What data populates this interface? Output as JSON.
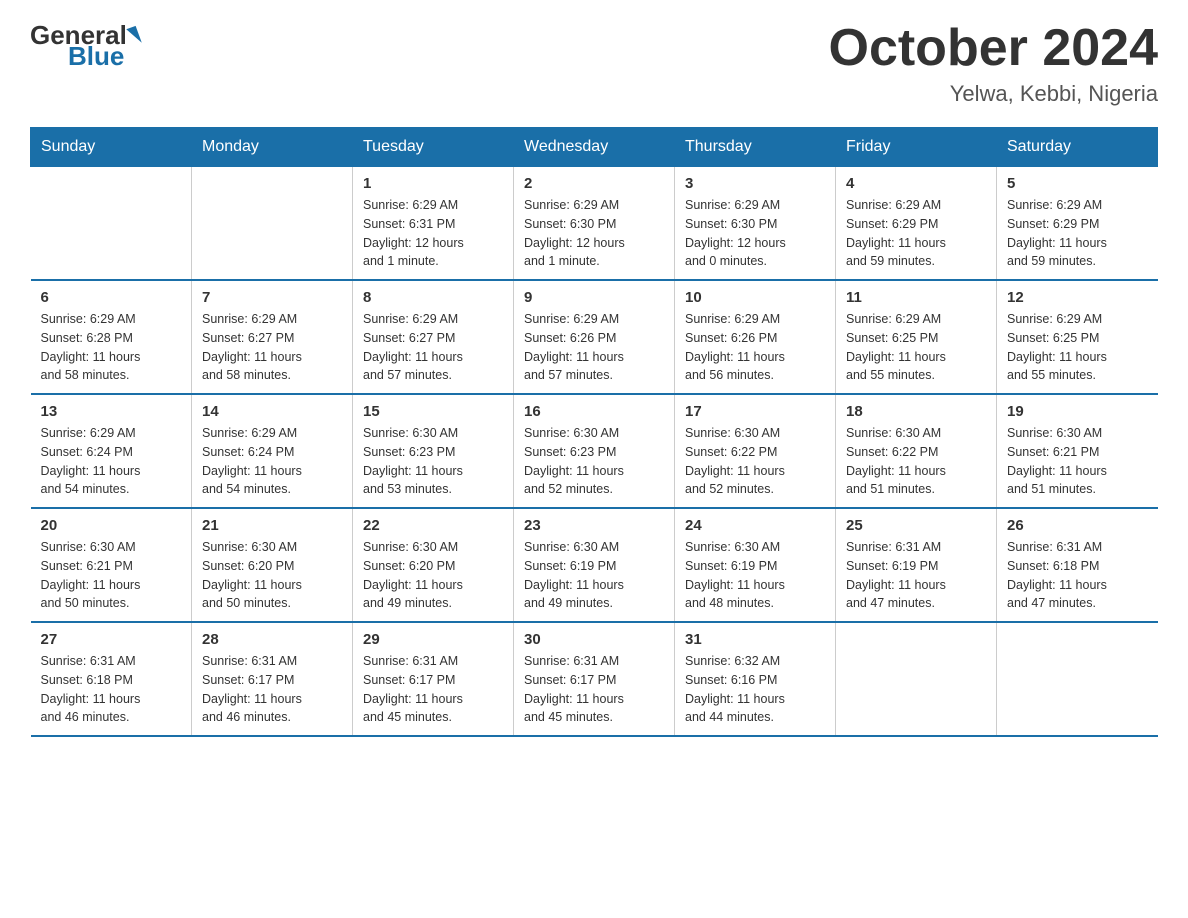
{
  "header": {
    "logo": {
      "general": "General",
      "blue": "Blue",
      "tagline": "Blue"
    },
    "title": "October 2024",
    "location": "Yelwa, Kebbi, Nigeria"
  },
  "weekdays": [
    "Sunday",
    "Monday",
    "Tuesday",
    "Wednesday",
    "Thursday",
    "Friday",
    "Saturday"
  ],
  "weeks": [
    [
      {
        "day": "",
        "info": ""
      },
      {
        "day": "",
        "info": ""
      },
      {
        "day": "1",
        "info": "Sunrise: 6:29 AM\nSunset: 6:31 PM\nDaylight: 12 hours\nand 1 minute."
      },
      {
        "day": "2",
        "info": "Sunrise: 6:29 AM\nSunset: 6:30 PM\nDaylight: 12 hours\nand 1 minute."
      },
      {
        "day": "3",
        "info": "Sunrise: 6:29 AM\nSunset: 6:30 PM\nDaylight: 12 hours\nand 0 minutes."
      },
      {
        "day": "4",
        "info": "Sunrise: 6:29 AM\nSunset: 6:29 PM\nDaylight: 11 hours\nand 59 minutes."
      },
      {
        "day": "5",
        "info": "Sunrise: 6:29 AM\nSunset: 6:29 PM\nDaylight: 11 hours\nand 59 minutes."
      }
    ],
    [
      {
        "day": "6",
        "info": "Sunrise: 6:29 AM\nSunset: 6:28 PM\nDaylight: 11 hours\nand 58 minutes."
      },
      {
        "day": "7",
        "info": "Sunrise: 6:29 AM\nSunset: 6:27 PM\nDaylight: 11 hours\nand 58 minutes."
      },
      {
        "day": "8",
        "info": "Sunrise: 6:29 AM\nSunset: 6:27 PM\nDaylight: 11 hours\nand 57 minutes."
      },
      {
        "day": "9",
        "info": "Sunrise: 6:29 AM\nSunset: 6:26 PM\nDaylight: 11 hours\nand 57 minutes."
      },
      {
        "day": "10",
        "info": "Sunrise: 6:29 AM\nSunset: 6:26 PM\nDaylight: 11 hours\nand 56 minutes."
      },
      {
        "day": "11",
        "info": "Sunrise: 6:29 AM\nSunset: 6:25 PM\nDaylight: 11 hours\nand 55 minutes."
      },
      {
        "day": "12",
        "info": "Sunrise: 6:29 AM\nSunset: 6:25 PM\nDaylight: 11 hours\nand 55 minutes."
      }
    ],
    [
      {
        "day": "13",
        "info": "Sunrise: 6:29 AM\nSunset: 6:24 PM\nDaylight: 11 hours\nand 54 minutes."
      },
      {
        "day": "14",
        "info": "Sunrise: 6:29 AM\nSunset: 6:24 PM\nDaylight: 11 hours\nand 54 minutes."
      },
      {
        "day": "15",
        "info": "Sunrise: 6:30 AM\nSunset: 6:23 PM\nDaylight: 11 hours\nand 53 minutes."
      },
      {
        "day": "16",
        "info": "Sunrise: 6:30 AM\nSunset: 6:23 PM\nDaylight: 11 hours\nand 52 minutes."
      },
      {
        "day": "17",
        "info": "Sunrise: 6:30 AM\nSunset: 6:22 PM\nDaylight: 11 hours\nand 52 minutes."
      },
      {
        "day": "18",
        "info": "Sunrise: 6:30 AM\nSunset: 6:22 PM\nDaylight: 11 hours\nand 51 minutes."
      },
      {
        "day": "19",
        "info": "Sunrise: 6:30 AM\nSunset: 6:21 PM\nDaylight: 11 hours\nand 51 minutes."
      }
    ],
    [
      {
        "day": "20",
        "info": "Sunrise: 6:30 AM\nSunset: 6:21 PM\nDaylight: 11 hours\nand 50 minutes."
      },
      {
        "day": "21",
        "info": "Sunrise: 6:30 AM\nSunset: 6:20 PM\nDaylight: 11 hours\nand 50 minutes."
      },
      {
        "day": "22",
        "info": "Sunrise: 6:30 AM\nSunset: 6:20 PM\nDaylight: 11 hours\nand 49 minutes."
      },
      {
        "day": "23",
        "info": "Sunrise: 6:30 AM\nSunset: 6:19 PM\nDaylight: 11 hours\nand 49 minutes."
      },
      {
        "day": "24",
        "info": "Sunrise: 6:30 AM\nSunset: 6:19 PM\nDaylight: 11 hours\nand 48 minutes."
      },
      {
        "day": "25",
        "info": "Sunrise: 6:31 AM\nSunset: 6:19 PM\nDaylight: 11 hours\nand 47 minutes."
      },
      {
        "day": "26",
        "info": "Sunrise: 6:31 AM\nSunset: 6:18 PM\nDaylight: 11 hours\nand 47 minutes."
      }
    ],
    [
      {
        "day": "27",
        "info": "Sunrise: 6:31 AM\nSunset: 6:18 PM\nDaylight: 11 hours\nand 46 minutes."
      },
      {
        "day": "28",
        "info": "Sunrise: 6:31 AM\nSunset: 6:17 PM\nDaylight: 11 hours\nand 46 minutes."
      },
      {
        "day": "29",
        "info": "Sunrise: 6:31 AM\nSunset: 6:17 PM\nDaylight: 11 hours\nand 45 minutes."
      },
      {
        "day": "30",
        "info": "Sunrise: 6:31 AM\nSunset: 6:17 PM\nDaylight: 11 hours\nand 45 minutes."
      },
      {
        "day": "31",
        "info": "Sunrise: 6:32 AM\nSunset: 6:16 PM\nDaylight: 11 hours\nand 44 minutes."
      },
      {
        "day": "",
        "info": ""
      },
      {
        "day": "",
        "info": ""
      }
    ]
  ]
}
